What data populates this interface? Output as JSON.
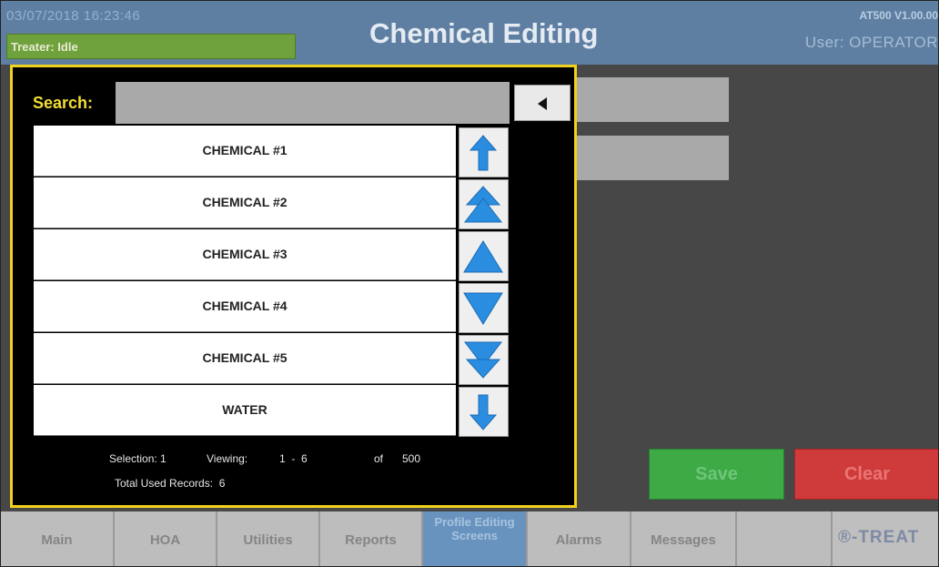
{
  "header": {
    "datetime": "03/07/2018 16:23:46",
    "treater_status": "Treater: Idle",
    "title": "Chemical Editing",
    "version": "AT500 V1.00.00",
    "user": "User: OPERATOR"
  },
  "search": {
    "label": "Search:",
    "value": "",
    "placeholder": ""
  },
  "list": {
    "items": [
      {
        "label": "CHEMICAL #1"
      },
      {
        "label": "CHEMICAL #2"
      },
      {
        "label": "CHEMICAL #3"
      },
      {
        "label": "CHEMICAL #4"
      },
      {
        "label": "CHEMICAL #5"
      },
      {
        "label": "WATER"
      }
    ]
  },
  "scroll_buttons": [
    {
      "name": "scroll-top-button",
      "icon": "arrow-up-to-top-icon"
    },
    {
      "name": "page-up-button",
      "icon": "double-triangle-up-icon"
    },
    {
      "name": "line-up-button",
      "icon": "triangle-up-icon"
    },
    {
      "name": "line-down-button",
      "icon": "triangle-down-icon"
    },
    {
      "name": "page-down-button",
      "icon": "double-triangle-down-icon"
    },
    {
      "name": "scroll-bottom-button",
      "icon": "arrow-down-to-bottom-icon"
    }
  ],
  "status": {
    "selection": "Selection: 1",
    "viewing_label": "Viewing:",
    "viewing_range": "1  -  6",
    "of_label": "of",
    "total": "500",
    "total_used": "Total Used Records:  6"
  },
  "actions": {
    "save": "Save",
    "clear": "Clear"
  },
  "nav": {
    "tabs": [
      {
        "label": "Main"
      },
      {
        "label": "HOA"
      },
      {
        "label": "Utilities"
      },
      {
        "label": "Reports"
      },
      {
        "label": "Profile Editing Screens",
        "active": true
      },
      {
        "label": "Alarms"
      },
      {
        "label": "Messages"
      },
      {
        "label": ""
      }
    ],
    "logo": "®-TREAT"
  },
  "colors": {
    "header_bg": "#5f7fa2",
    "popup_border": "#f0d21c",
    "save": "#3daa45",
    "clear": "#cf3b3b",
    "active_tab": "#6993bf",
    "arrow_blue": "#2a8de0"
  }
}
